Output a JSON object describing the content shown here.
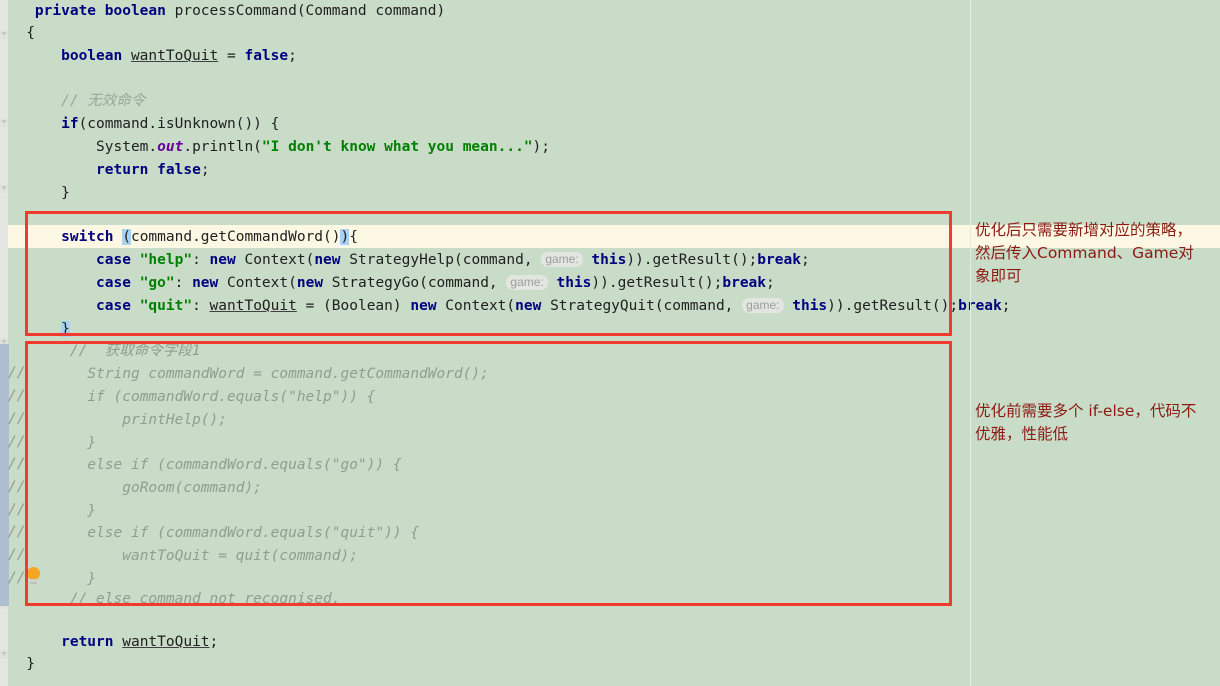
{
  "editor": {
    "language": "Java",
    "theme_background": "#c9dcc8",
    "current_line_highlight": "#fdf8e3",
    "annotation_box_color": "#f23a2e",
    "annotation_text_color": "#8b1a13",
    "keyword_color": "#000080",
    "string_color": "#008000",
    "comment_color": "#9aa79b"
  },
  "code": {
    "signature": {
      "modifier": "private",
      "return_type": "boolean",
      "name": "processCommand(Command command)"
    },
    "open_brace": "{",
    "local_var": {
      "type": "boolean",
      "name": "wantToQuit",
      "eq": " = ",
      "value": "false",
      "semi": ";"
    },
    "comment_invalid": "// 无效命令",
    "if_unknown": {
      "kw": "if",
      "cond": "(command.isUnknown()) {"
    },
    "println": {
      "prefix": "System.",
      "field": "out",
      "mid": ".println(",
      "string": "\"I don't know what you mean...\"",
      "suffix": ");"
    },
    "return_false": {
      "kw": "return",
      "val": "false",
      "semi": ";"
    },
    "close_if": "}",
    "switch_line": {
      "kw": "switch",
      "space": " ",
      "open_paren": "(",
      "expr": "command.getCommandWord()",
      "close_paren": ")",
      "brace": "{"
    },
    "cases": [
      {
        "kw": "case",
        "label": "\"help\"",
        "colon": ": ",
        "body_a": "new",
        "body_b": " Context(",
        "body_c": "new",
        "body_d": " StrategyHelp(command, ",
        "hint": "game:",
        "this": "this",
        "body_e": ")).getResult();",
        "brk": "break",
        "semi": ";"
      },
      {
        "kw": "case",
        "label": "\"go\"",
        "colon": ": ",
        "body_a": "new",
        "body_b": " Context(",
        "body_c": "new",
        "body_d": " StrategyGo(command, ",
        "hint": "game:",
        "this": "this",
        "body_e": ")).getResult();",
        "brk": "break",
        "semi": ";"
      },
      {
        "kw": "case",
        "label": "\"quit\"",
        "colon": ": ",
        "assign_var": "wantToQuit",
        "assign_eq": " = (Boolean) ",
        "body_a": "new",
        "body_b": " Context(",
        "body_c": "new",
        "body_d": " StrategyQuit(command, ",
        "hint": "game:",
        "this": "this",
        "body_e": ")).getResult();",
        "brk": "break",
        "semi": ";"
      }
    ],
    "close_switch": "}",
    "commented_block": {
      "header": "//  获取命令字段1",
      "lines": [
        "String commandWord = command.getCommandWord();",
        "if (commandWord.equals(\"help\")) {",
        "    printHelp();",
        "}",
        "else if (commandWord.equals(\"go\")) {",
        "    goRoom(command);",
        "}",
        "else if (commandWord.equals(\"quit\")) {",
        "    wantToQuit = quit(command);",
        "}"
      ],
      "footer": "// else command not recognised.",
      "gutter_prefix": "//"
    },
    "return_stmt": {
      "kw": "return",
      "var": "wantToQuit",
      "semi": ";"
    },
    "close_method": "}"
  },
  "annotations": [
    {
      "id": "after-optimization",
      "text": "优化后只需要新增对应的策略，然后传入Command、Game对象即可"
    },
    {
      "id": "before-optimization",
      "text": "优化前需要多个 if-else，代码不优雅，性能低"
    }
  ],
  "icons": {
    "lightbulb": "lightbulb-icon",
    "fold": "code-fold-icon"
  }
}
